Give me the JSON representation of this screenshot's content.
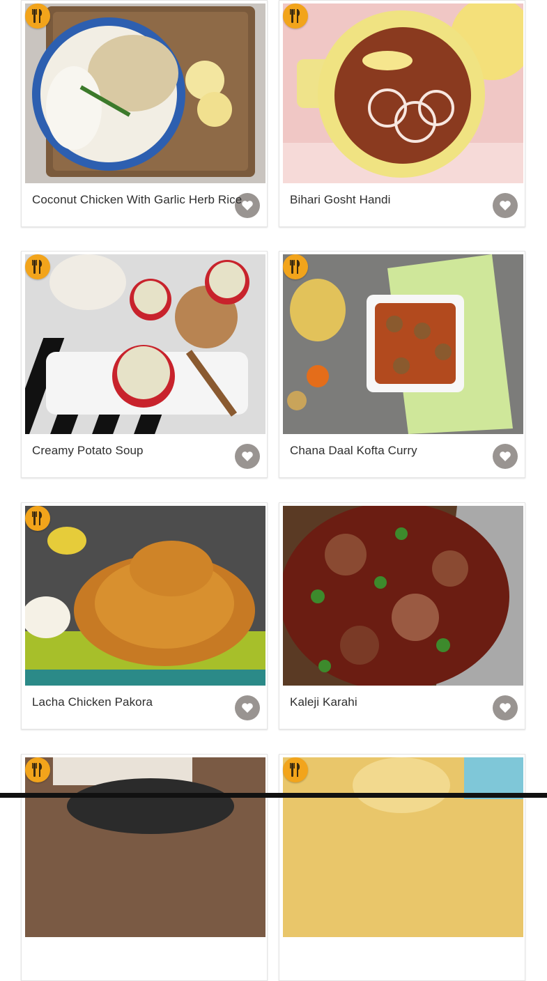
{
  "recipes": [
    {
      "title": "Coconut Chicken With Garlic Herb Rice"
    },
    {
      "title": "Bihari Gosht Handi"
    },
    {
      "title": "Creamy Potato Soup"
    },
    {
      "title": "Chana Daal Kofta Curry"
    },
    {
      "title": "Lacha Chicken Pakora"
    },
    {
      "title": "Kaleji Karahi"
    },
    {
      "title": ""
    },
    {
      "title": ""
    }
  ],
  "icons": {
    "badge": "fork-knife-icon",
    "favorite": "heart-icon"
  },
  "colors": {
    "badge": "#f2a41b",
    "title_text": "#2e2e2e",
    "card_border": "#e4e4e4"
  }
}
